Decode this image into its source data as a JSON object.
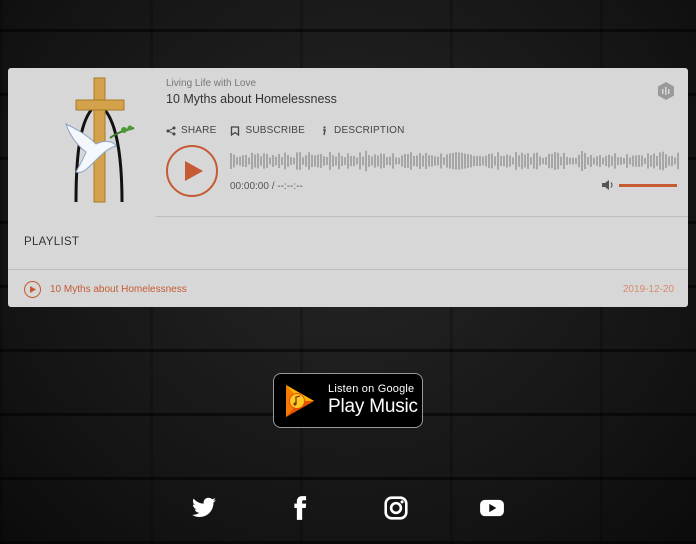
{
  "player": {
    "show_name": "Living Life with Love",
    "episode_title": "10 Myths about Homelessness",
    "actions": {
      "share": "SHARE",
      "subscribe": "SUBSCRIBE",
      "description": "DESCRIPTION"
    },
    "time_display": "00:00:00 / --:--:--",
    "accent_color": "#c65a33",
    "playlist_label": "PLAYLIST",
    "tracks": [
      {
        "title": "10 Myths about Homelessness",
        "date": "2019-12-20"
      }
    ]
  },
  "google_play": {
    "small_text": "Listen on Google",
    "big_text": "Play Music"
  },
  "social": [
    "twitter-icon",
    "facebook-icon",
    "instagram-icon",
    "youtube-icon"
  ]
}
